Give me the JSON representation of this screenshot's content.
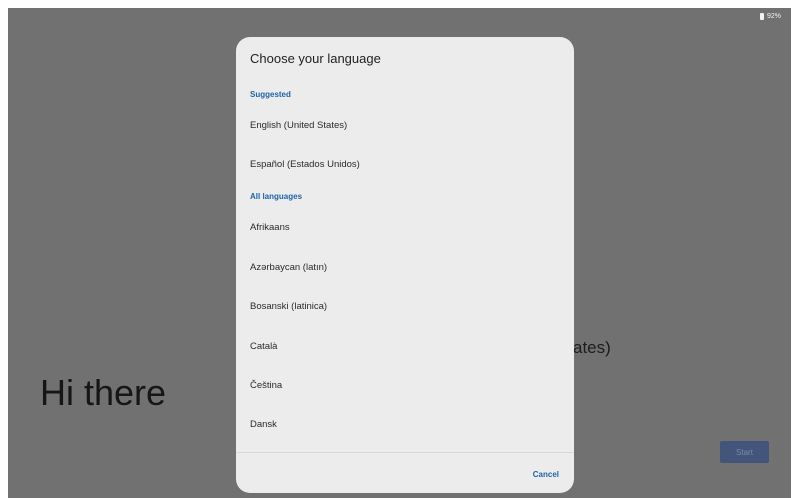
{
  "status": {
    "battery_text": "92%"
  },
  "background": {
    "greeting": "Hi there",
    "language_fragment": "ates)",
    "start_label": "Start"
  },
  "dialog": {
    "title": "Choose your language",
    "suggested_header": "Suggested",
    "suggested": [
      "English (United States)",
      "Español (Estados Unidos)"
    ],
    "all_header": "All languages",
    "languages": [
      "Afrikaans",
      "Azərbaycan (latın)",
      "Bosanski (latinica)",
      "Català",
      "Čeština",
      "Dansk"
    ],
    "cancel_label": "Cancel"
  },
  "colors": {
    "accent": "#1d63a8",
    "scrim": "#717171",
    "dialog_bg": "#ececec",
    "start_button": "#43557a"
  }
}
